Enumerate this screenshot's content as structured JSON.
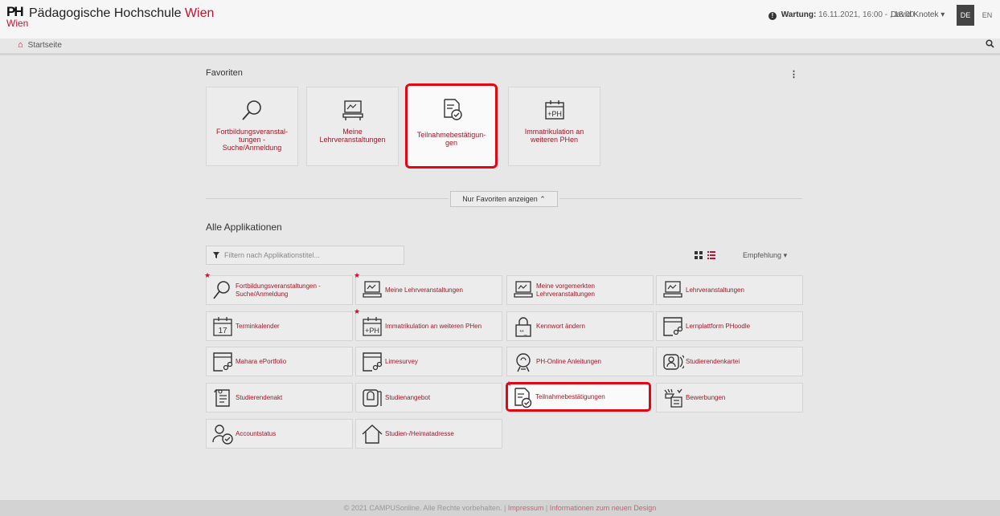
{
  "header": {
    "logo_text": "PH",
    "logo_city": "Wien",
    "site_name": "Pädagogische Hochschule",
    "site_name_accent": "Wien",
    "maintenance_label": "Wartung:",
    "maintenance_value": "16.11.2021, 16:00 - , 18:00",
    "user_name": "David Knotek",
    "lang_de": "DE",
    "lang_en": "EN",
    "home_label": "Startseite"
  },
  "favorites": {
    "title": "Favoriten",
    "tiles": [
      {
        "label": "Fortbildungsveranstal- tungen - Suche/Anmeldung",
        "icon": "search-icon"
      },
      {
        "label": "Meine Lehrveranstaltungen",
        "icon": "lecture-icon"
      },
      {
        "label": "Teilnahmebestätigun- gen",
        "icon": "certificate-check-icon"
      },
      {
        "label": "Immatrikulation an weiteren PHen",
        "icon": "ph-calendar-icon"
      }
    ],
    "toggle_label": "Nur Favoriten anzeigen"
  },
  "apps": {
    "title": "Alle Applikationen",
    "filter_placeholder": "Filtern nach Applikationstitel...",
    "sort_label": "Empfehlung",
    "items": [
      {
        "label": "Fortbildungsveranstaltungen - Suche/Anmeldung",
        "icon": "search-icon",
        "favorite": true
      },
      {
        "label": "Meine Lehrveranstaltungen",
        "icon": "lecture-icon",
        "favorite": true
      },
      {
        "label": "Meine vorgemerkten Lehrveranstaltungen",
        "icon": "lecture-icon",
        "favorite": false
      },
      {
        "label": "Lehrveranstaltungen",
        "icon": "lecture-icon",
        "favorite": false
      },
      {
        "label": "Terminkalender",
        "icon": "calendar-icon",
        "calendar_day": "17",
        "favorite": false
      },
      {
        "label": "Immatrikulation an weiteren PHen",
        "icon": "ph-calendar-icon",
        "favorite": true
      },
      {
        "label": "Kennwort ändern",
        "icon": "lock-icon",
        "favorite": false
      },
      {
        "label": "Lernplattform PHoodle",
        "icon": "window-link-icon",
        "favorite": false
      },
      {
        "label": "Mahara ePortfolio",
        "icon": "window-link-icon",
        "favorite": false
      },
      {
        "label": "Limesurvey",
        "icon": "window-link-icon",
        "favorite": false
      },
      {
        "label": "PH-Online Anleitungen",
        "icon": "lightbulb-icon",
        "favorite": false
      },
      {
        "label": "Studierendenkartei",
        "icon": "contact-card-icon",
        "favorite": false
      },
      {
        "label": "Studierendenakt",
        "icon": "file-folder-icon",
        "favorite": false
      },
      {
        "label": "Studienangebot",
        "icon": "book-icon",
        "favorite": false
      },
      {
        "label": "Teilnahmebestätigungen",
        "icon": "certificate-check-icon",
        "favorite": true
      },
      {
        "label": "Bewerbungen",
        "icon": "application-hand-icon",
        "favorite": false
      },
      {
        "label": "Accountstatus",
        "icon": "user-check-icon",
        "favorite": false
      },
      {
        "label": "Studien-/Heimatadresse",
        "icon": "home-icon",
        "favorite": false
      }
    ]
  },
  "footer": {
    "copyright": "© 2021 CAMPUSonline. Alle Rechte vorbehalten.",
    "impressum": "Impressum",
    "design_info": "Informationen zum neuen Design"
  },
  "colors": {
    "accent": "#c8102e",
    "label_red": "#9a1a2a",
    "highlight_border": "#e30613"
  }
}
